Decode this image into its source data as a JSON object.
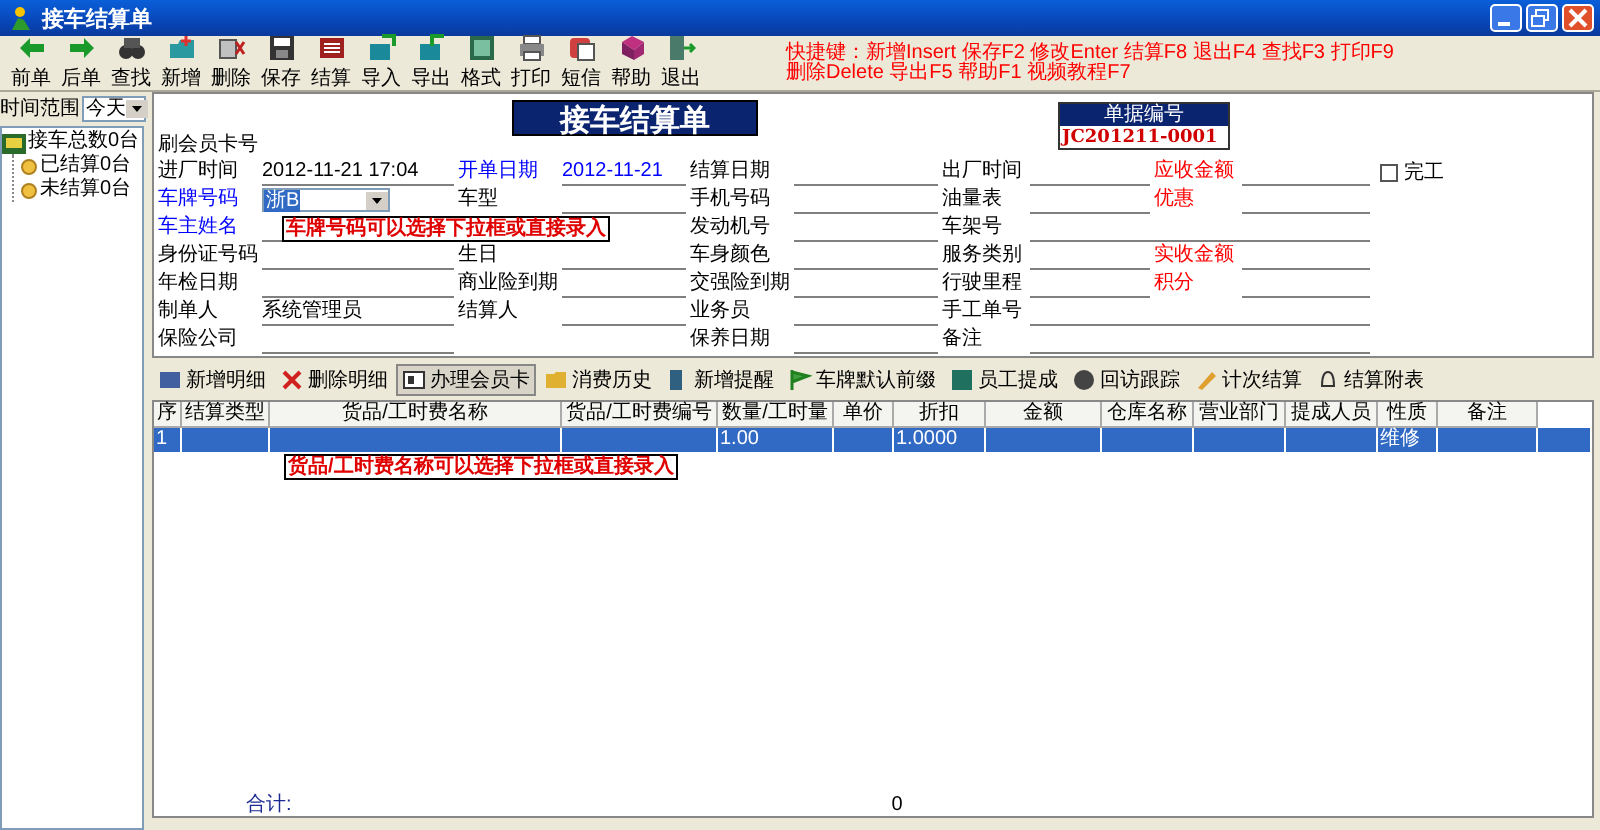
{
  "window": {
    "title": "接车结算单"
  },
  "toolbar": [
    {
      "label": "前单"
    },
    {
      "label": "后单"
    },
    {
      "label": "查找"
    },
    {
      "label": "新增"
    },
    {
      "label": "删除"
    },
    {
      "label": "保存"
    },
    {
      "label": "结算"
    },
    {
      "label": "导入"
    },
    {
      "label": "导出"
    },
    {
      "label": "格式"
    },
    {
      "label": "打印"
    },
    {
      "label": "短信"
    },
    {
      "label": "帮助"
    },
    {
      "label": "退出"
    }
  ],
  "shortcuts": [
    "快捷键：新增Insert 保存F2 修改Enter 结算F8 退出F4 查找F3 打印F9",
    "删除Delete 导出F5 帮助F1 视频教程F7"
  ],
  "sidebar": {
    "range_label": "时间范围",
    "range_value": "今天",
    "tree": [
      {
        "label": "接车总数0台",
        "expanded": true,
        "children": [
          {
            "label": "已结算0台"
          },
          {
            "label": "未结算0台"
          }
        ]
      }
    ]
  },
  "form": {
    "member_label": "刷会员卡号",
    "title": "接车结算单",
    "doc_number": {
      "label": "单据编号",
      "value": "JC201211-0001"
    },
    "rows": [
      [
        {
          "label": "进厂时间",
          "value": "2012-11-21 17:04",
          "kind": "line"
        },
        {
          "label": "开单日期",
          "value": "2012-11-21",
          "kind": "line",
          "color": "#0000ff"
        },
        {
          "label": "结算日期",
          "kind": "line"
        },
        {
          "label": "出厂时间",
          "kind": "line"
        },
        {
          "label": "应收金额",
          "kind": "line",
          "color": "#ff0000"
        }
      ],
      [
        {
          "label": "车牌号码",
          "value": "浙B",
          "highlighted": true,
          "kind": "combo",
          "color": "#0000ff"
        },
        {
          "label": "车型",
          "kind": "line"
        },
        {
          "label": "手机号码",
          "kind": "line"
        },
        {
          "label": "油量表",
          "kind": "line"
        },
        {
          "label": "优惠",
          "kind": "line",
          "color": "#ff0000"
        }
      ],
      [
        {
          "label": "车主姓名",
          "kind": "line",
          "color": "#0000ff"
        },
        null,
        {
          "label": "发动机号",
          "kind": "line"
        },
        {
          "label": "车架号",
          "kind": "wide"
        },
        null
      ],
      [
        {
          "label": "身份证号码",
          "kind": "line"
        },
        {
          "label": "生日",
          "kind": "line"
        },
        {
          "label": "车身颜色",
          "kind": "line"
        },
        {
          "label": "服务类别",
          "kind": "line"
        },
        {
          "label": "实收金额",
          "kind": "line",
          "color": "#ff0000"
        }
      ],
      [
        {
          "label": "年检日期",
          "kind": "line"
        },
        {
          "label": "商业险到期",
          "kind": "line"
        },
        {
          "label": "交强险到期",
          "kind": "line"
        },
        {
          "label": "行驶里程",
          "kind": "line"
        },
        {
          "label": "积分",
          "kind": "line",
          "color": "#ff0000"
        }
      ],
      [
        {
          "label": "制单人",
          "value": "系统管理员",
          "kind": "line"
        },
        {
          "label": "结算人",
          "kind": "line"
        },
        {
          "label": "业务员",
          "kind": "line"
        },
        {
          "label": "手工单号",
          "kind": "wide"
        },
        null
      ],
      [
        {
          "label": "保险公司",
          "kind": "line"
        },
        null,
        {
          "label": "保养日期",
          "kind": "line"
        },
        {
          "label": "备注",
          "kind": "wide"
        },
        null
      ]
    ],
    "complete": {
      "label": "完工",
      "checked": false
    },
    "hint": "车牌号码可以选择下拉框或直接录入"
  },
  "tabs": [
    {
      "label": "新增明细",
      "selected": false
    },
    {
      "label": "删除明细",
      "selected": false
    },
    {
      "label": "办理会员卡",
      "selected": true
    },
    {
      "label": "消费历史",
      "selected": false
    },
    {
      "label": "新增提醒",
      "selected": false
    },
    {
      "label": "车牌默认前缀",
      "selected": false
    },
    {
      "label": "员工提成",
      "selected": false
    },
    {
      "label": "回访跟踪",
      "selected": false
    },
    {
      "label": "计次结算",
      "selected": false
    },
    {
      "label": "结算附表",
      "selected": false
    }
  ],
  "grid": {
    "columns": [
      "序",
      "结算类型",
      "货品/工时费名称",
      "货品/工时费编号",
      "数量/工时量",
      "单价",
      "折扣",
      "金额",
      "仓库名称",
      "营业部门",
      "提成人员",
      "性质",
      "备注"
    ],
    "rows": [
      {
        "selected": true,
        "cells": [
          "1",
          null,
          null,
          null,
          "1.00",
          null,
          "1.0000",
          null,
          null,
          null,
          null,
          "维修",
          null
        ]
      }
    ],
    "hint": "货品/工时费名称可以选择下拉框或直接录入",
    "total_label": "合计:",
    "total_value": "0"
  }
}
